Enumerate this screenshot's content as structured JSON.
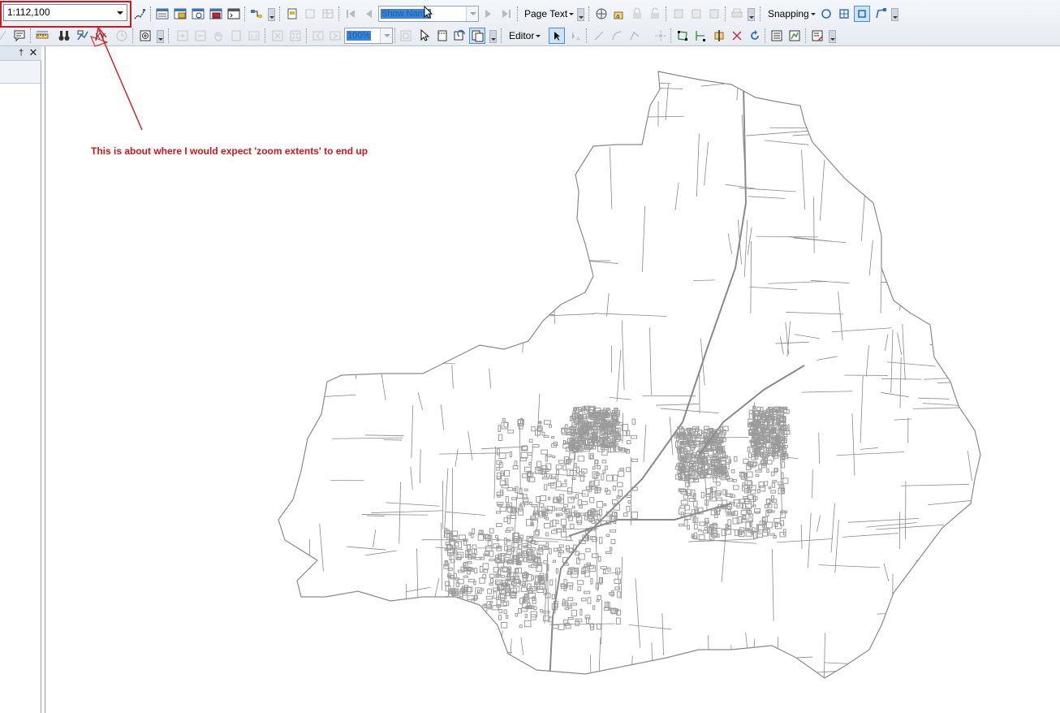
{
  "toolbar": {
    "scale_value": "1:112,100",
    "page_name_placeholder": "Show Name",
    "page_text_label": "Page Text",
    "zoom_percent": "100%",
    "editor_label": "Editor",
    "snapping_label": "Snapping"
  },
  "dock": {
    "pin_glyph": "†",
    "close_glyph": "✕"
  },
  "annotation": {
    "text": "This is about where I would expect 'zoom extents' to end up",
    "color": "#d01818"
  },
  "map": {
    "parcel_stroke": "#8a8a8a",
    "urban_fill": "#9b9b9b"
  }
}
